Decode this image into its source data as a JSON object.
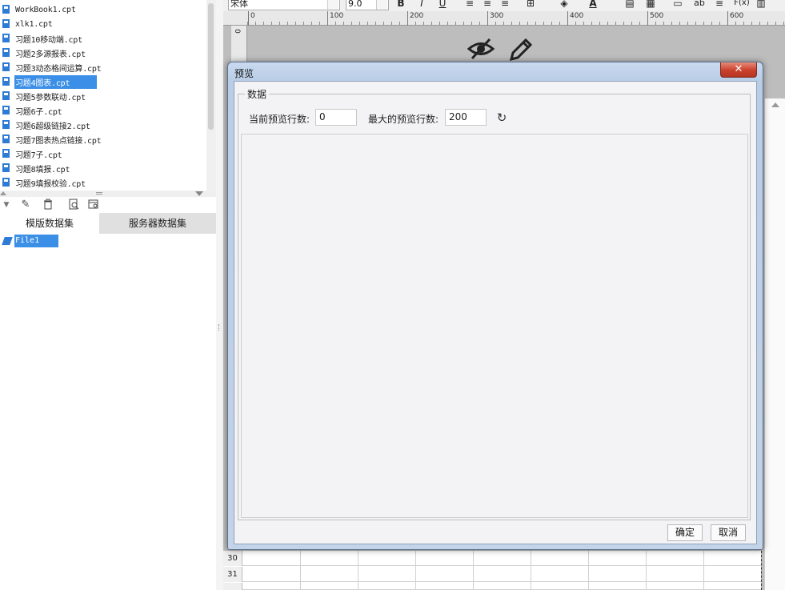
{
  "file_list": [
    {
      "label": "WorkBook1.cpt",
      "selected": false
    },
    {
      "label": "xlk1.cpt",
      "selected": false
    },
    {
      "label": "习题10移动端.cpt",
      "selected": false
    },
    {
      "label": "习题2多源报表.cpt",
      "selected": false
    },
    {
      "label": "习题3动态格间运算.cpt",
      "selected": false
    },
    {
      "label": "习题4图表.cpt",
      "selected": true
    },
    {
      "label": "习题5参数联动.cpt",
      "selected": false
    },
    {
      "label": "习题6子.cpt",
      "selected": false
    },
    {
      "label": "习题6超级链接2.cpt",
      "selected": false
    },
    {
      "label": "习题7图表热点链接.cpt",
      "selected": false
    },
    {
      "label": "习题7子.cpt",
      "selected": false
    },
    {
      "label": "习题8填报.cpt",
      "selected": false
    },
    {
      "label": "习题9填报校验.cpt",
      "selected": false
    }
  ],
  "dataset_tabs": {
    "template": "模版数据集",
    "server": "服务器数据集"
  },
  "dataset_item": "File1",
  "format_bar": {
    "font": "宋体",
    "size": "9.0",
    "bold": "B",
    "italic": "I",
    "underline": "U",
    "color_a": "A",
    "ab": "ab",
    "fx": "F(x)"
  },
  "ruler": {
    "ticks": [
      "0",
      "100",
      "200",
      "300",
      "400",
      "500",
      "600"
    ],
    "vertical_zero": "0"
  },
  "grid_rows": [
    "30",
    "31"
  ],
  "dialog": {
    "title": "预览",
    "close_symbol": "✕",
    "group_label": "数据",
    "current_rows_label": "当前预览行数:",
    "current_rows_value": "0",
    "max_rows_label": "最大的预览行数:",
    "max_rows_value": "200",
    "ok_label": "确定",
    "cancel_label": "取消"
  },
  "icons": {
    "refresh": "↻",
    "edit": "✎",
    "delete": "🗑",
    "preview_hidden": "eye-slash-icon",
    "pencil": "pencil-icon"
  }
}
